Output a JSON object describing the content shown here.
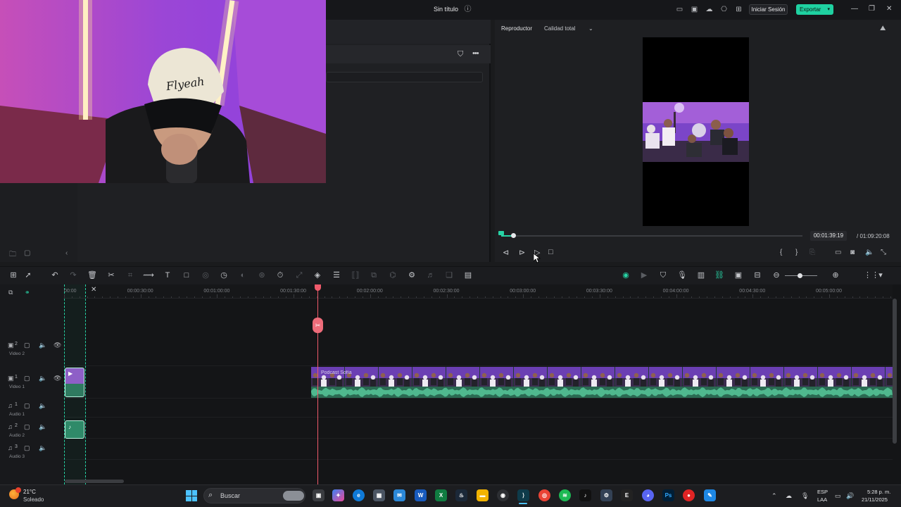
{
  "window": {
    "title": "Sin título",
    "login_label": "Iniciar Sesión",
    "export_label": "Exportar"
  },
  "player": {
    "label": "Reproductor",
    "quality": "Calidad total",
    "timecode": "00:01:39:19",
    "duration": "/ 01:09:20:08",
    "progress": 0.04
  },
  "timeline": {
    "ruler": [
      "00:00",
      "00:00:30:00",
      "00:01:00:00",
      "00:01:30:00",
      "00:02:00:00",
      "00:02:30:00",
      "00:03:00:00",
      "00:03:30:00",
      "00:04:00:00",
      "00:04:30:00",
      "00:05:00:00"
    ],
    "tracks": [
      {
        "num": "2",
        "label": "Video 2",
        "kind": "video"
      },
      {
        "num": "1",
        "label": "Video 1",
        "kind": "video"
      },
      {
        "num": "1",
        "label": "Audio 1",
        "kind": "audio"
      },
      {
        "num": "2",
        "label": "Audio 2",
        "kind": "audio"
      },
      {
        "num": "3",
        "label": "Audio 3",
        "kind": "audio"
      }
    ],
    "clip_name": "Podcast Sofía"
  },
  "taskbar": {
    "temp": "21°C",
    "weather": "Soleado",
    "search": "Buscar",
    "lang1": "ESP",
    "lang2": "LAA",
    "time": "5:28 p. m.",
    "date": "21/11/2025"
  },
  "colors": {
    "accent": "#27d3a5",
    "playhead": "#ef5a6b",
    "export": "#1fd1a1"
  }
}
